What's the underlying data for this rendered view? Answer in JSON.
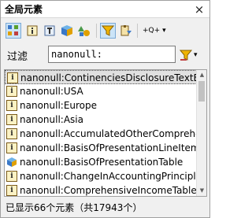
{
  "window": {
    "title": "全局元素",
    "close_glyph": "×"
  },
  "toolbar": {
    "buttons": [
      {
        "icon": "grid-view-icon"
      },
      {
        "icon": "info-filter-icon"
      },
      {
        "icon": "text-filter-icon"
      },
      {
        "icon": "cube-filter-icon"
      },
      {
        "icon": "shapes-filter-icon"
      },
      {
        "icon": "funnel-filter-icon",
        "active": true
      },
      {
        "icon": "clipboard-tools-icon"
      },
      {
        "icon": "add-dropdown-icon",
        "label": "+Q+"
      }
    ],
    "add_label": "+Q+",
    "add_arrow": "▾"
  },
  "filter": {
    "label": "过滤",
    "value": "nanonull:",
    "dropdown_arrow": "▾"
  },
  "list": {
    "items": [
      {
        "text": "nanonull:ContinenciesDisclosureTextBl...",
        "icon": "i",
        "selected": true
      },
      {
        "text": "nanonull:USA",
        "icon": "i"
      },
      {
        "text": "nanonull:Europe",
        "icon": "i"
      },
      {
        "text": "nanonull:Asia",
        "icon": "i"
      },
      {
        "text": "nanonull:AccumulatedOtherComprehe...",
        "icon": "i"
      },
      {
        "text": "nanonull:BasisOfPresentationLineItems",
        "icon": "i"
      },
      {
        "text": "nanonull:BasisOfPresentationTable",
        "icon": "cube"
      },
      {
        "text": "nanonull:ChangeInAccountingPrinciple",
        "icon": "i"
      },
      {
        "text": "nanonull:ComprehensiveIncomeTableT...",
        "icon": "i"
      }
    ],
    "icon_letter": "i",
    "scroll_up": "▲",
    "scroll_down": "▼"
  },
  "status": {
    "text": "已显示66个元素（共17943个）"
  },
  "colors": {
    "accent": "#cce4f7",
    "filter_icon": "#e0a000"
  }
}
